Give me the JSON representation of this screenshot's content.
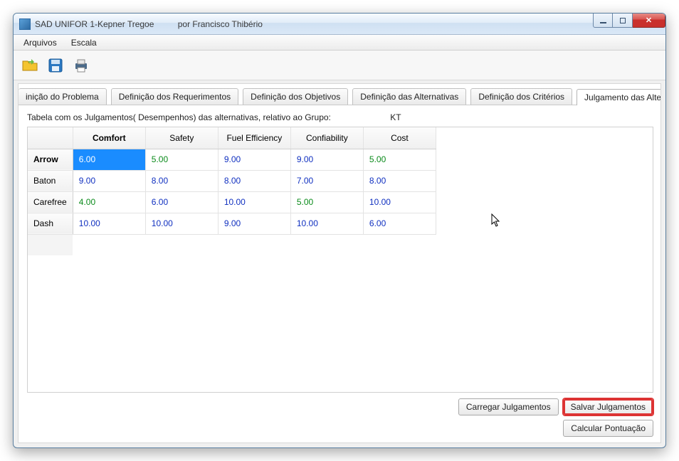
{
  "window": {
    "title_app": "SAD UNIFOR 1-Kepner Tregoe",
    "title_author": "por Francisco Thibério"
  },
  "menu": {
    "arquivos": "Arquivos",
    "escala": "Escala"
  },
  "tabs": {
    "t1": "inição do Problema",
    "t2": "Definição dos Requerimentos",
    "t3": "Definição dos Objetivos",
    "t4": "Definição das Alternativas",
    "t5": "Definição dos Critérios",
    "t6": "Julgamento das Alternativas"
  },
  "panel": {
    "desc": "Tabela com os Julgamentos( Desempenhos) das alternativas, relativo ao Grupo:",
    "group": "KT"
  },
  "table": {
    "headers": {
      "blank": "",
      "c1": "Comfort",
      "c2": "Safety",
      "c3": "Fuel Efficiency",
      "c4": "Confiability",
      "c5": "Cost"
    },
    "rows": [
      {
        "name": "Arrow",
        "v": [
          "6.00",
          "5.00",
          "9.00",
          "9.00",
          "5.00"
        ],
        "active": true,
        "greens": [
          1,
          4
        ]
      },
      {
        "name": "Baton",
        "v": [
          "9.00",
          "8.00",
          "8.00",
          "7.00",
          "8.00"
        ],
        "greens": []
      },
      {
        "name": "Carefree",
        "v": [
          "4.00",
          "6.00",
          "10.00",
          "5.00",
          "10.00"
        ],
        "greens": [
          0,
          3
        ]
      },
      {
        "name": "Dash",
        "v": [
          "10.00",
          "10.00",
          "9.00",
          "10.00",
          "6.00"
        ],
        "greens": []
      }
    ]
  },
  "buttons": {
    "carregar": "Carregar Julgamentos",
    "salvar": "Salvar Julgamentos",
    "calcular": "Calcular Pontuação"
  }
}
